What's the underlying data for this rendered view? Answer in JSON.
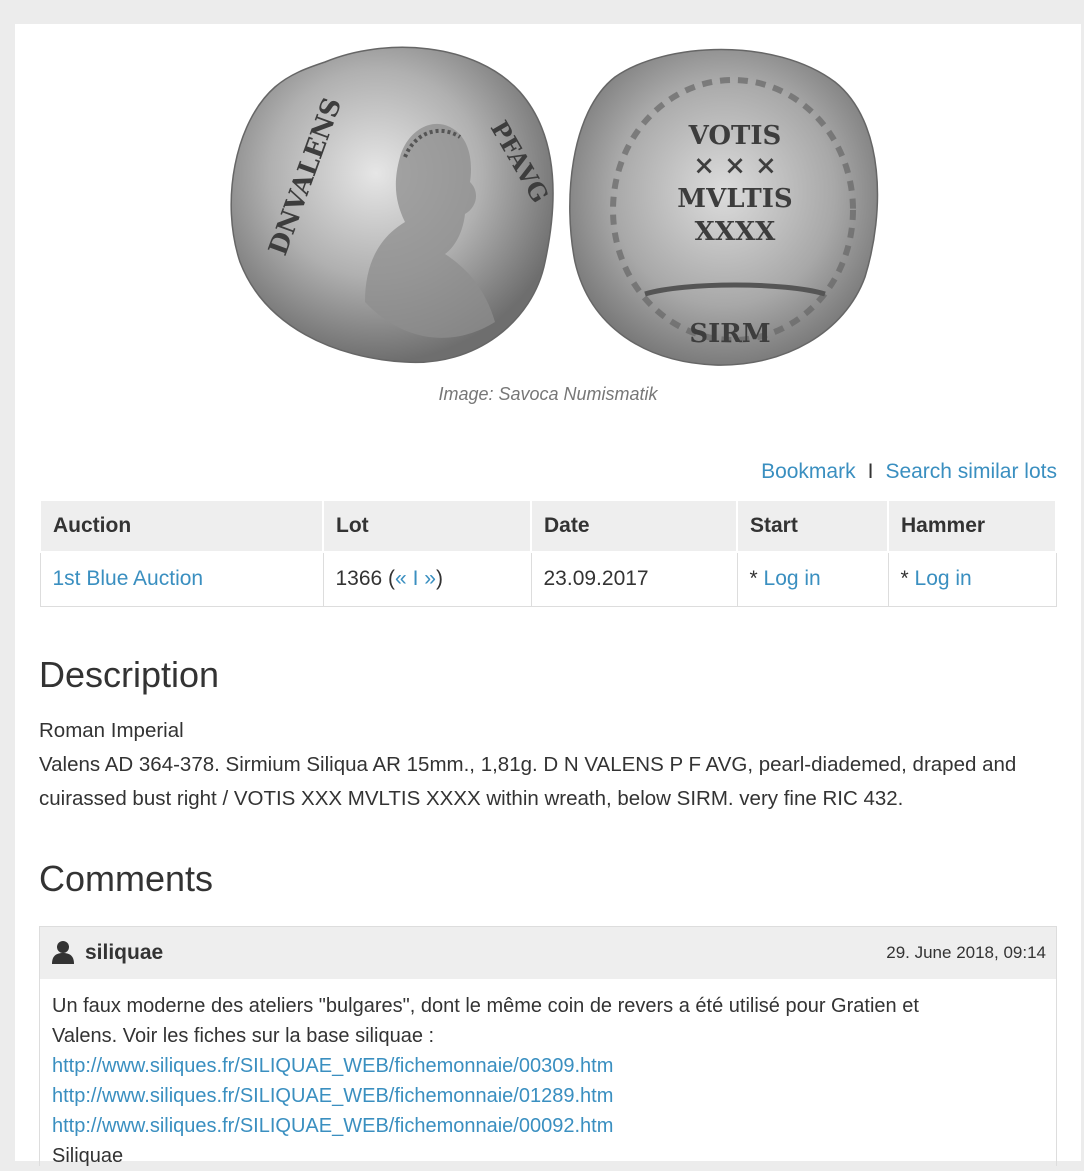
{
  "image": {
    "caption": "Image: Savoca Numismatik",
    "obverse_legend_left": "DNVALENS",
    "obverse_legend_right": "PFAVG",
    "reverse_lines": [
      "VOTIS",
      "× × ×",
      "MVLTIS",
      "XXXX"
    ],
    "reverse_exergue": "SIRM"
  },
  "actions": {
    "bookmark": "Bookmark",
    "separator": "I",
    "search_similar": "Search similar lots"
  },
  "table": {
    "headers": [
      "Auction",
      "Lot",
      "Date",
      "Start",
      "Hammer"
    ],
    "row": {
      "auction": "1st Blue Auction",
      "lot_number": "1366 (",
      "lot_prev": "«",
      "lot_sep": " I ",
      "lot_next": "»",
      "lot_close": ")",
      "date": "23.09.2017",
      "start_prefix": "* ",
      "start_link": "Log in",
      "hammer_prefix": "* ",
      "hammer_link": "Log in"
    }
  },
  "description": {
    "title": "Description",
    "category": "Roman Imperial",
    "text": "Valens AD 364-378. Sirmium Siliqua AR 15mm., 1,81g. D N VALENS P F AVG, pearl-diademed, draped and cuirassed bust right / VOTIS XXX MVLTIS XXXX within wreath, below SIRM. very fine RIC 432."
  },
  "comments": {
    "title": "Comments",
    "items": [
      {
        "user": "siliquae",
        "date": "29. June 2018, 09:14",
        "text_line1": "Un faux moderne des ateliers \"bulgares\", dont le même coin de revers a été utilisé pour Gratien et",
        "text_line2": "Valens. Voir les fiches sur la base siliquae :",
        "links": [
          "http://www.siliques.fr/SILIQUAE_WEB/fichemonnaie/00309.htm",
          "http://www.siliques.fr/SILIQUAE_WEB/fichemonnaie/01289.htm",
          "http://www.siliques.fr/SILIQUAE_WEB/fichemonnaie/00092.htm"
        ],
        "signature": "Siliquae"
      }
    ]
  },
  "colors": {
    "link": "#3a8fc0",
    "header_bg": "#eeeeee",
    "coin_silver": "#b8b8b8"
  }
}
